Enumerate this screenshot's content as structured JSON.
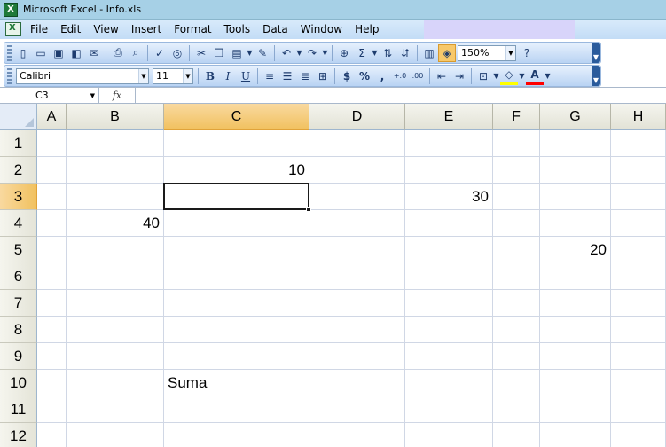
{
  "window": {
    "title": "Microsoft Excel - Info.xls"
  },
  "menu": {
    "items": [
      {
        "key": "file",
        "label": "File"
      },
      {
        "key": "edit",
        "label": "Edit"
      },
      {
        "key": "view",
        "label": "View"
      },
      {
        "key": "insert",
        "label": "Insert"
      },
      {
        "key": "format",
        "label": "Format"
      },
      {
        "key": "tools",
        "label": "Tools"
      },
      {
        "key": "data",
        "label": "Data"
      },
      {
        "key": "window",
        "label": "Window"
      },
      {
        "key": "help",
        "label": "Help"
      }
    ]
  },
  "toolbar_standard": {
    "zoom": "150%",
    "icons": [
      "new-icon",
      "open-icon",
      "save-icon",
      "permission-icon",
      "email-icon",
      "print-icon",
      "print-preview-icon",
      "spelling-icon",
      "research-icon",
      "cut-icon",
      "copy-icon",
      "paste-icon",
      "format-painter-icon",
      "undo-icon",
      "redo-icon",
      "hyperlink-icon",
      "autosum-icon",
      "sort-ascending-icon",
      "sort-descending-icon",
      "chart-wizard-icon",
      "drawing-icon",
      "help-icon"
    ]
  },
  "toolbar_formatting": {
    "font": "Calibri",
    "size": "11",
    "bold": "B",
    "italic": "I",
    "underline": "U",
    "currency": "$",
    "percent": "%",
    "comma": ",",
    "increase_decimal": "+.0",
    "decrease_decimal": ".00",
    "font_color_label": "A"
  },
  "formula_bar": {
    "name_box": "C3",
    "fx_label": "fx",
    "content": ""
  },
  "sheet": {
    "active_cell": "C3",
    "columns": [
      "A",
      "B",
      "C",
      "D",
      "E",
      "F",
      "G",
      "H"
    ],
    "rows": [
      "1",
      "2",
      "3",
      "4",
      "5",
      "6",
      "7",
      "8",
      "9",
      "10",
      "11",
      "12"
    ],
    "cells": [
      {
        "ref": "C2",
        "value": "10",
        "type": "num"
      },
      {
        "ref": "E3",
        "value": "30",
        "type": "num"
      },
      {
        "ref": "B4",
        "value": "40",
        "type": "num"
      },
      {
        "ref": "G5",
        "value": "20",
        "type": "num"
      },
      {
        "ref": "C10",
        "value": "Suma",
        "type": "text"
      }
    ]
  },
  "colors": {
    "selection_header": "#f1c15f",
    "gridline": "#d0d7e5",
    "title_bar": "#a6d0e6"
  }
}
